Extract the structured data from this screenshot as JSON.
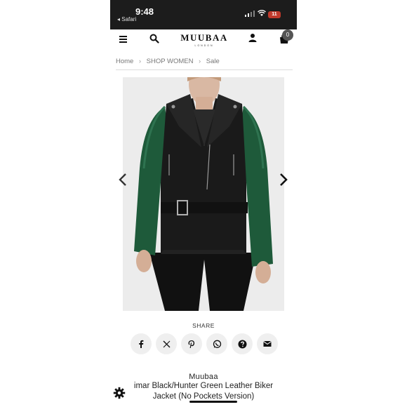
{
  "status_bar": {
    "time": "9:48",
    "back_app": "◂ Safari",
    "battery": "11"
  },
  "header": {
    "brand": "MUUBAA",
    "brand_sub": "LONDON",
    "cart_count": "0"
  },
  "breadcrumb": {
    "items": [
      "Home",
      "SHOP WOMEN",
      "Sale"
    ],
    "separator": "›"
  },
  "gallery": {
    "image_name": "black-hunter-green-leather-biker-jacket"
  },
  "share": {
    "label": "SHARE",
    "buttons": [
      "facebook-icon",
      "x-icon",
      "pinterest-icon",
      "whatsapp-icon",
      "help-icon",
      "email-icon"
    ]
  },
  "product": {
    "brand": "Muubaa",
    "title_line1": "imar Black/Hunter Green Leather Biker",
    "title_line2": "Jacket (No Pockets Version)"
  },
  "colors": {
    "status_bar": "#1c1c1c",
    "jacket_leather": "#1a1a1a",
    "jacket_sleeve": "#1e5a3a",
    "battery": "#c0392b"
  }
}
